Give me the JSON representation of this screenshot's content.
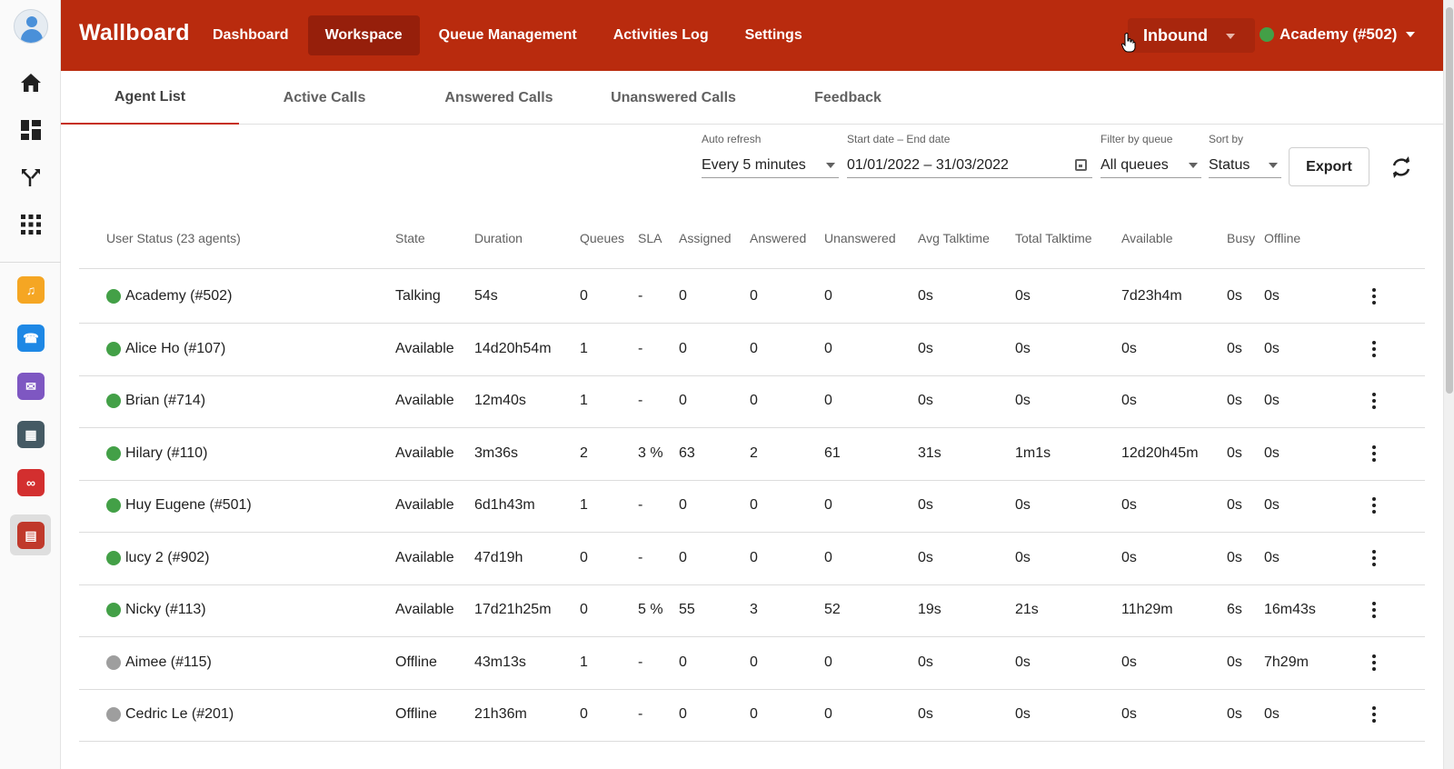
{
  "topbar": {
    "brand": "Wallboard",
    "nav": [
      "Dashboard",
      "Workspace",
      "Queue Management",
      "Activities Log",
      "Settings"
    ],
    "active_nav": "Workspace",
    "direction": "Inbound",
    "account": "Academy (#502)",
    "colors": {
      "bar": "#b92b0e",
      "active": "#961f0b",
      "online": "#43a047"
    }
  },
  "sidebar": {
    "nav_icons": [
      "home-icon",
      "dashboard-icon",
      "call-flow-icon",
      "apps-grid-icon"
    ],
    "apps": [
      {
        "name": "headset-app-icon",
        "color": "#f5a623"
      },
      {
        "name": "phone-app-icon",
        "color": "#1e88e5"
      },
      {
        "name": "mail-app-icon",
        "color": "#7e57c2"
      },
      {
        "name": "voip-phone-app-icon",
        "color": "#455a64"
      },
      {
        "name": "voicemail-app-icon",
        "color": "#d32f2f"
      },
      {
        "name": "wallboard-app-icon",
        "color": "#c0392b"
      }
    ]
  },
  "tabs": [
    "Agent List",
    "Active Calls",
    "Answered Calls",
    "Unanswered Calls",
    "Feedback"
  ],
  "filters": {
    "auto_refresh": {
      "label": "Auto refresh",
      "value": "Every 5 minutes"
    },
    "date_range": {
      "label": "Start date – End date",
      "value": "01/01/2022 – 31/03/2022"
    },
    "queue": {
      "label": "Filter by queue",
      "value": "All queues"
    },
    "sort": {
      "label": "Sort by",
      "value": "Status"
    },
    "export_label": "Export"
  },
  "table": {
    "headers": [
      "User Status (23 agents)",
      "State",
      "Duration",
      "Queues",
      "SLA",
      "Assigned",
      "Answered",
      "Unanswered",
      "Avg Talktime",
      "Total Talktime",
      "Available",
      "Busy",
      "Offline"
    ],
    "rows": [
      {
        "status": "online",
        "name": "Academy (#502)",
        "state": "Talking",
        "duration": "54s",
        "queues": "0",
        "sla": "-",
        "assigned": "0",
        "answered": "0",
        "unanswered": "0",
        "avg": "0s",
        "total": "0s",
        "available": "7d23h4m",
        "busy": "0s",
        "offline": "0s"
      },
      {
        "status": "online",
        "name": "Alice Ho (#107)",
        "state": "Available",
        "duration": "14d20h54m",
        "queues": "1",
        "sla": "-",
        "assigned": "0",
        "answered": "0",
        "unanswered": "0",
        "avg": "0s",
        "total": "0s",
        "available": "0s",
        "busy": "0s",
        "offline": "0s"
      },
      {
        "status": "online",
        "name": "Brian (#714)",
        "state": "Available",
        "duration": "12m40s",
        "queues": "1",
        "sla": "-",
        "assigned": "0",
        "answered": "0",
        "unanswered": "0",
        "avg": "0s",
        "total": "0s",
        "available": "0s",
        "busy": "0s",
        "offline": "0s"
      },
      {
        "status": "online",
        "name": "Hilary (#110)",
        "state": "Available",
        "duration": "3m36s",
        "queues": "2",
        "sla": "3 %",
        "assigned": "63",
        "answered": "2",
        "unanswered": "61",
        "avg": "31s",
        "total": "1m1s",
        "available": "12d20h45m",
        "busy": "0s",
        "offline": "0s"
      },
      {
        "status": "online",
        "name": "Huy Eugene (#501)",
        "state": "Available",
        "duration": "6d1h43m",
        "queues": "1",
        "sla": "-",
        "assigned": "0",
        "answered": "0",
        "unanswered": "0",
        "avg": "0s",
        "total": "0s",
        "available": "0s",
        "busy": "0s",
        "offline": "0s"
      },
      {
        "status": "online",
        "name": "lucy 2 (#902)",
        "state": "Available",
        "duration": "47d19h",
        "queues": "0",
        "sla": "-",
        "assigned": "0",
        "answered": "0",
        "unanswered": "0",
        "avg": "0s",
        "total": "0s",
        "available": "0s",
        "busy": "0s",
        "offline": "0s"
      },
      {
        "status": "online",
        "name": "Nicky (#113)",
        "state": "Available",
        "duration": "17d21h25m",
        "queues": "0",
        "sla": "5 %",
        "assigned": "55",
        "answered": "3",
        "unanswered": "52",
        "avg": "19s",
        "total": "21s",
        "available": "11h29m",
        "busy": "6s",
        "offline": "16m43s"
      },
      {
        "status": "offline",
        "name": "Aimee (#115)",
        "state": "Offline",
        "duration": "43m13s",
        "queues": "1",
        "sla": "-",
        "assigned": "0",
        "answered": "0",
        "unanswered": "0",
        "avg": "0s",
        "total": "0s",
        "available": "0s",
        "busy": "0s",
        "offline": "7h29m"
      },
      {
        "status": "offline",
        "name": "Cedric Le (#201)",
        "state": "Offline",
        "duration": "21h36m",
        "queues": "0",
        "sla": "-",
        "assigned": "0",
        "answered": "0",
        "unanswered": "0",
        "avg": "0s",
        "total": "0s",
        "available": "0s",
        "busy": "0s",
        "offline": "0s"
      }
    ],
    "status_colors": {
      "online": "#43a047",
      "offline": "#9e9e9e"
    }
  }
}
